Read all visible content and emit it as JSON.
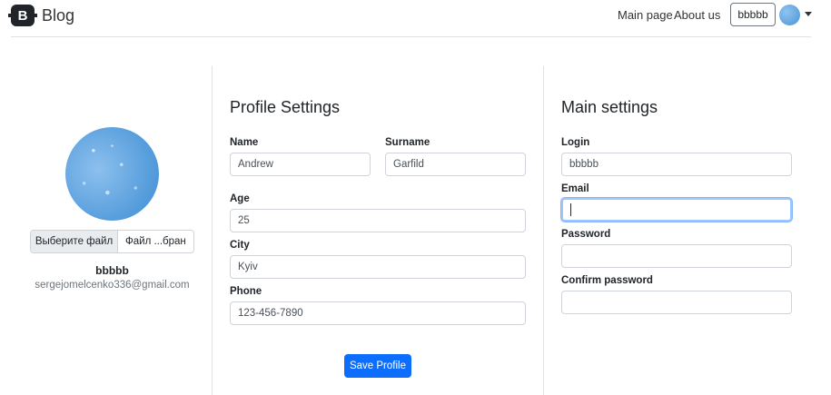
{
  "nav": {
    "brand_letter": "B",
    "brand_text": "Blog",
    "main_page": "Main page",
    "about_us": "About us",
    "user_button": "bbbbb"
  },
  "profile_card": {
    "file_button": "Выберите файл",
    "file_name": "Файл ...бран",
    "username": "bbbbb",
    "email": "sergejomelcenko336@gmail.com"
  },
  "profile_settings": {
    "title": "Profile Settings",
    "name_label": "Name",
    "name_value": "Andrew",
    "surname_label": "Surname",
    "surname_value": "Garfild",
    "age_label": "Age",
    "age_value": "25",
    "city_label": "City",
    "city_value": "Kyiv",
    "phone_label": "Phone",
    "phone_value": "123-456-7890",
    "save_button": "Save Profile"
  },
  "main_settings": {
    "title": "Main settings",
    "login_label": "Login",
    "login_value": "bbbbb",
    "email_label": "Email",
    "email_value": "",
    "password_label": "Password",
    "password_value": "",
    "confirm_label": "Confirm password",
    "confirm_value": ""
  },
  "colors": {
    "primary": "#0d6efd",
    "avatar": "#4a94d6"
  }
}
